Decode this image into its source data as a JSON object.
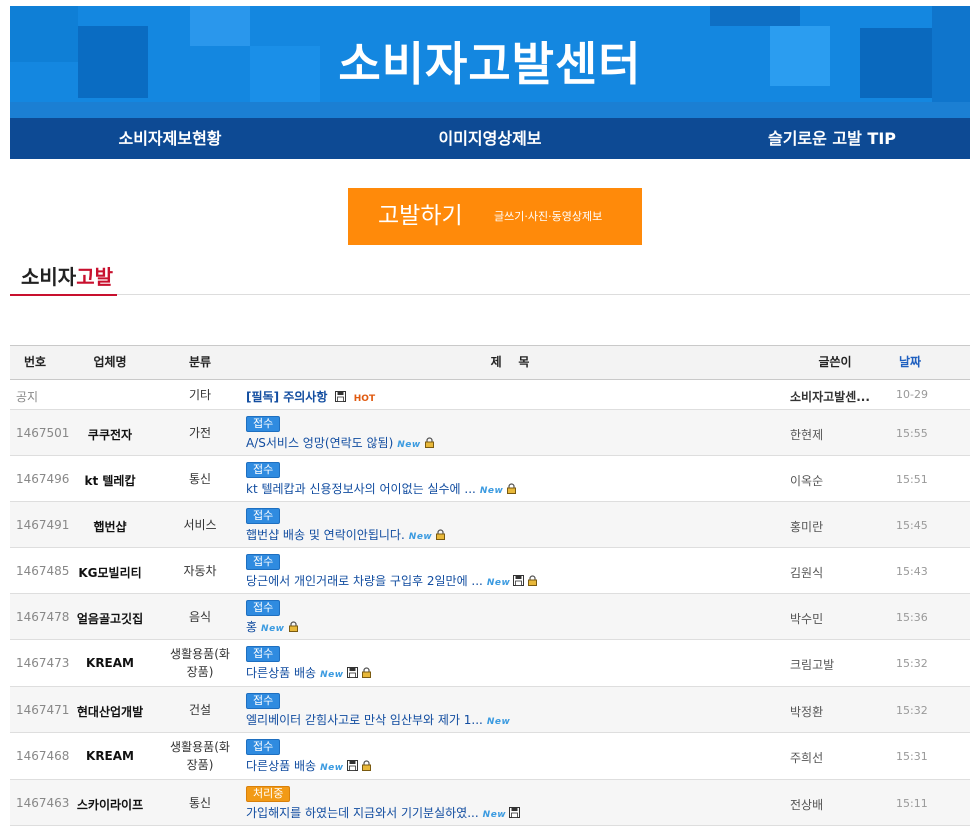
{
  "site": {
    "title": "소비자고발센터"
  },
  "nav": [
    {
      "label": "소비자제보현황"
    },
    {
      "label": "이미지영상제보"
    },
    {
      "label": "슬기로운 고발 TIP"
    }
  ],
  "report_button": {
    "label": "고발하기",
    "sublabel": "글쓰기·사진·동영상제보"
  },
  "section": {
    "title_prefix": "소비자",
    "title_accent": "고발"
  },
  "colors": {
    "header_blue": "#1487e0",
    "nav_navy": "#0d4a94",
    "button_orange": "#ff8a0a",
    "accent_red": "#c8102e",
    "badge_blue": "#2f8be0",
    "badge_orange": "#f29a16"
  },
  "table": {
    "headers": {
      "num": "번호",
      "company": "업체명",
      "category": "분류",
      "subject": "제    목",
      "author": "글쓴이",
      "date": "날짜"
    },
    "notice": {
      "num": "공지",
      "company": "",
      "category": "기타",
      "title": "[필독] 주의사항",
      "hot_label": "HOT",
      "author": "소비자고발센...",
      "date": "10-29"
    },
    "new_label": "New",
    "rows": [
      {
        "num": "1467501",
        "company": "쿠쿠전자",
        "category": "가전",
        "status": "접수",
        "title": "A/S서비스 엉망(연락도 않됨)",
        "author": "한현제",
        "date": "15:55"
      },
      {
        "num": "1467496",
        "company": "kt 텔레캅",
        "category": "통신",
        "status": "접수",
        "title": "kt 텔레캅과 신용정보사의 어이없는 실수에 ...",
        "author": "이옥순",
        "date": "15:51"
      },
      {
        "num": "1467491",
        "company": "햅번샵",
        "category": "서비스",
        "status": "접수",
        "title": "햅번샵 배송 및 연락이안됩니다.",
        "author": "홍미란",
        "date": "15:45"
      },
      {
        "num": "1467485",
        "company": "KG모빌리티",
        "category": "자동차",
        "status": "접수",
        "title": "당근에서 개인거래로 차량을 구입후 2일만에 ...",
        "author": "김원식",
        "date": "15:43"
      },
      {
        "num": "1467478",
        "company": "얼음골고깃집",
        "category": "음식",
        "status": "접수",
        "title": "홍",
        "author": "박수민",
        "date": "15:36"
      },
      {
        "num": "1467473",
        "company": "KREAM",
        "category": "생활용품(화장품)",
        "status": "접수",
        "title": "다른상품 배송",
        "author": "크림고발",
        "date": "15:32"
      },
      {
        "num": "1467471",
        "company": "현대산업개발",
        "category": "건설",
        "status": "접수",
        "title": "엘리베이터 갇힘사고로 만삭 임산부와 제가 1...",
        "author": "박정환",
        "date": "15:32"
      },
      {
        "num": "1467468",
        "company": "KREAM",
        "category": "생활용품(화장품)",
        "status": "접수",
        "title": "다른상품 배송",
        "author": "주희선",
        "date": "15:31"
      },
      {
        "num": "1467463",
        "company": "스카이라이프",
        "category": "통신",
        "status": "처리중",
        "title": "가입해지를 하였는데 지금와서 기기분실하였...",
        "author": "전상배",
        "date": "15:11"
      }
    ]
  }
}
